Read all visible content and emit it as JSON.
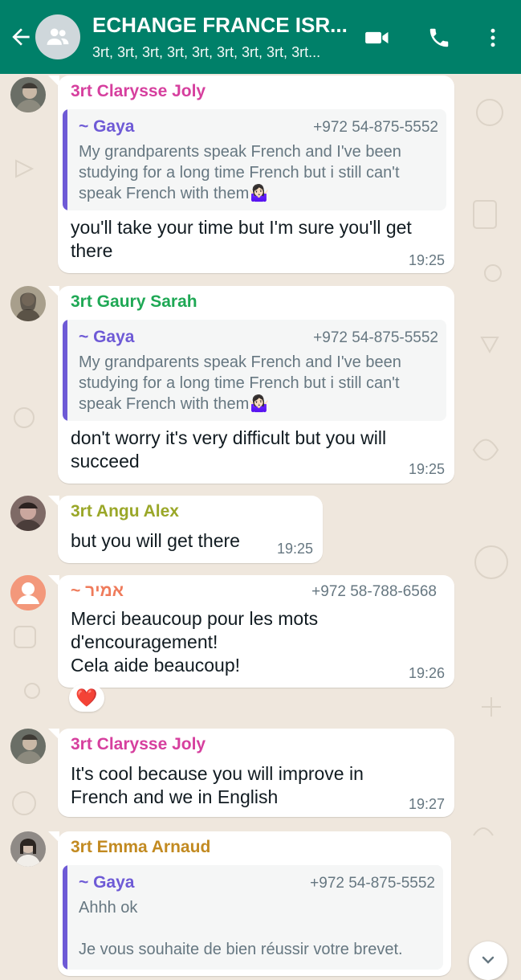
{
  "header": {
    "title": "ECHANGE FRANCE ISR...",
    "subtitle": "3rt, 3rt, 3rt, 3rt, 3rt, 3rt, 3rt, 3rt, 3rt..."
  },
  "messages": [
    {
      "sender": "3rt Clarysse Joly",
      "sender_color": "#d63f9e",
      "quote": {
        "author": "~ Gaya",
        "phone": "+972 54-875-5552",
        "text": "My grandparents speak French and I've been studying for a long time French but i still can't speak French with them🤷🏻‍♀️"
      },
      "text": "you'll take your time but I'm sure you'll get there",
      "time": "19:25"
    },
    {
      "sender": "3rt Gaury Sarah",
      "sender_color": "#1fa855",
      "quote": {
        "author": "~ Gaya",
        "phone": "+972 54-875-5552",
        "text": "My grandparents speak French and I've been studying for a long time French but i still can't speak French with them🤷🏻‍♀️"
      },
      "text": "don't worry it's very difficult but you will succeed",
      "time": "19:25"
    },
    {
      "sender": "3rt Angu Alex",
      "sender_color": "#9aa728",
      "text": "but you will get there",
      "time": "19:25"
    },
    {
      "sender": "~ אמיר",
      "sender_color": "#ef7b5b",
      "phone": "+972 58-788-6568",
      "text": "Merci beaucoup pour les mots d'encouragement!\nCela aide beaucoup!",
      "time": "19:26",
      "reaction": "❤️"
    },
    {
      "sender": "3rt Clarysse Joly",
      "sender_color": "#d63f9e",
      "text": "It's cool because you will improve in French and we in English",
      "time": "19:27"
    },
    {
      "sender": "3rt Emma Arnaud",
      "sender_color": "#c28a21",
      "quote": {
        "author": "~ Gaya",
        "phone": "+972 54-875-5552",
        "text": "Ahhh ok\n\nJe vous souhaite de bien réussir votre brevet."
      }
    }
  ],
  "icons": {
    "back": "arrow-left-icon",
    "group": "group-icon",
    "video": "video-call-icon",
    "call": "phone-icon",
    "menu": "more-vert-icon",
    "scroll": "chevron-down-icon"
  },
  "colors": {
    "header_bg": "#008069",
    "chat_bg": "#efe7dd",
    "quote_accent": "#6e5ad6"
  }
}
